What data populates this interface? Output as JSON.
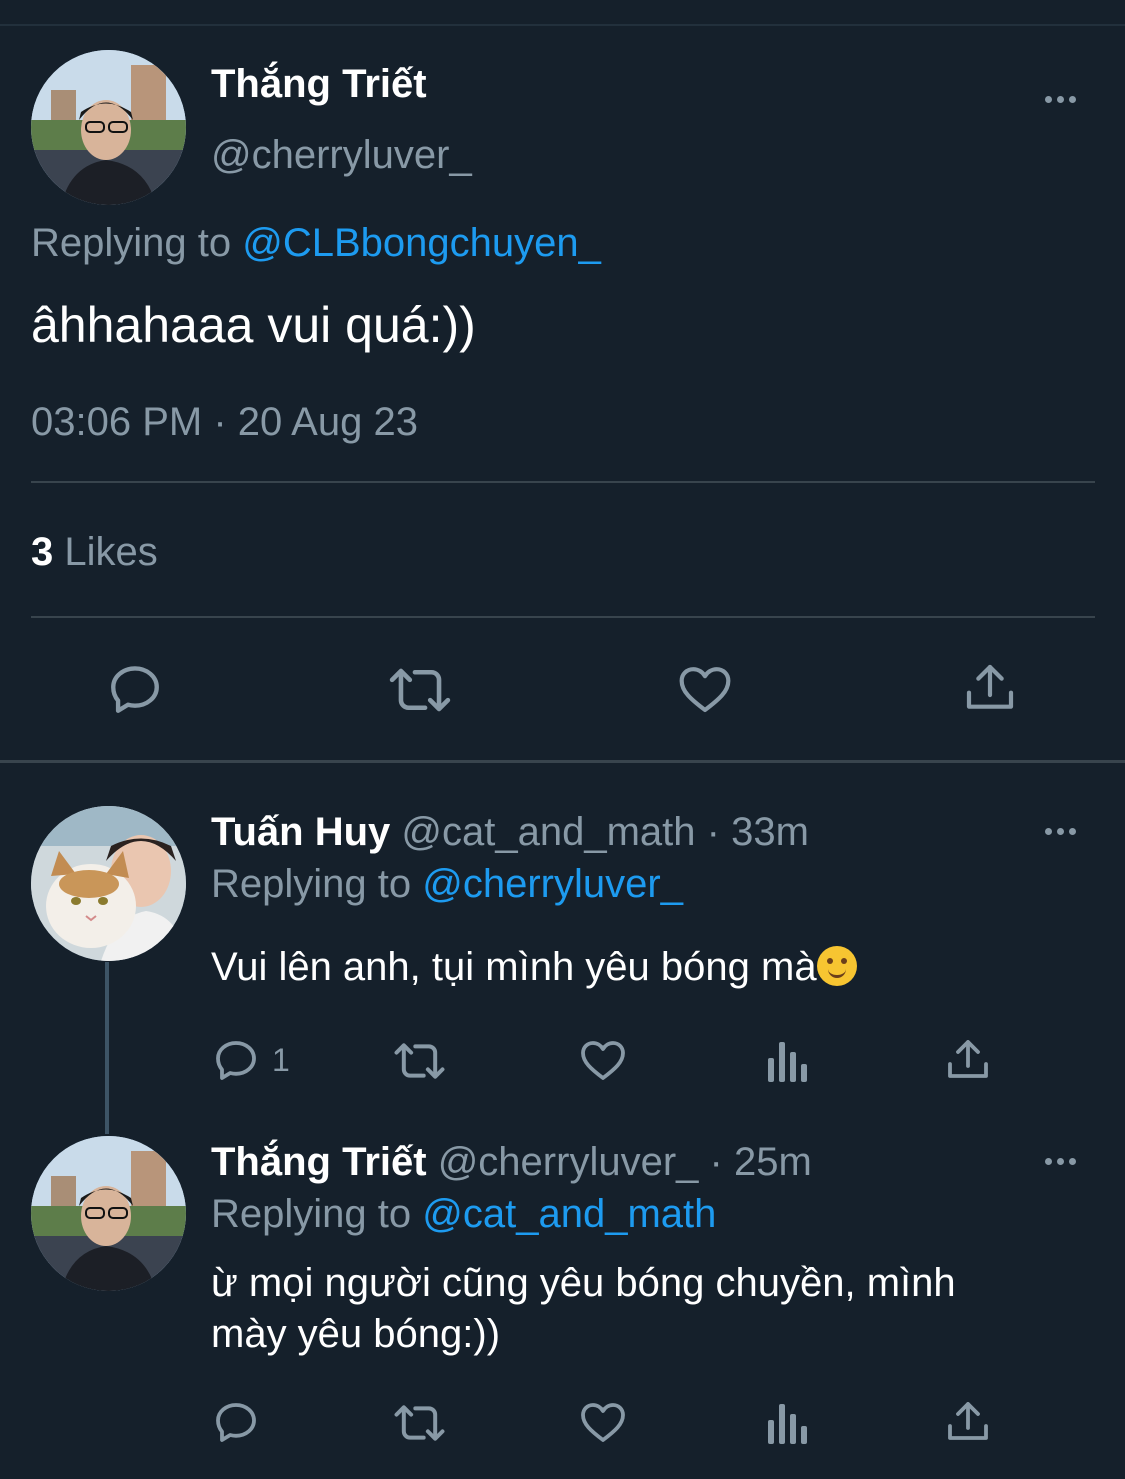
{
  "main_tweet": {
    "display_name": "Thắng Triết",
    "handle": "@cherryluver_",
    "replying_prefix": "Replying to",
    "replying_to": "@CLBbongchuyen_",
    "text": "âhhahaaa vui quá:))",
    "timestamp": "03:06 PM · 20 Aug 23",
    "likes_count": "3",
    "likes_label": "Likes"
  },
  "reply_1": {
    "display_name": "Tuấn Huy",
    "handle": "@cat_and_math",
    "time": "· 33m",
    "replying_prefix": "Replying to",
    "replying_to": "@cherryluver_",
    "text": "Vui lên anh, tụi mình yêu bóng mà",
    "reply_count": "1"
  },
  "reply_2": {
    "display_name": "Thắng Triết",
    "handle": "@cherryluver_",
    "time": "· 25m",
    "replying_prefix": "Replying to",
    "replying_to": "@cat_and_math",
    "text_line1": "ừ mọi người cũng yêu bóng chuyền, mình",
    "text_line2": "mày yêu bóng:))"
  },
  "icons": {
    "reply": "reply-icon",
    "retweet": "retweet-icon",
    "like": "heart-icon",
    "share": "share-icon",
    "analytics": "analytics-icon",
    "more": "more-icon",
    "emoji": "smiling-face-emoji"
  },
  "colors": {
    "background": "#15202b",
    "accent": "#1d9bf0",
    "secondary_text": "#8899a6",
    "divider": "#38444d"
  }
}
